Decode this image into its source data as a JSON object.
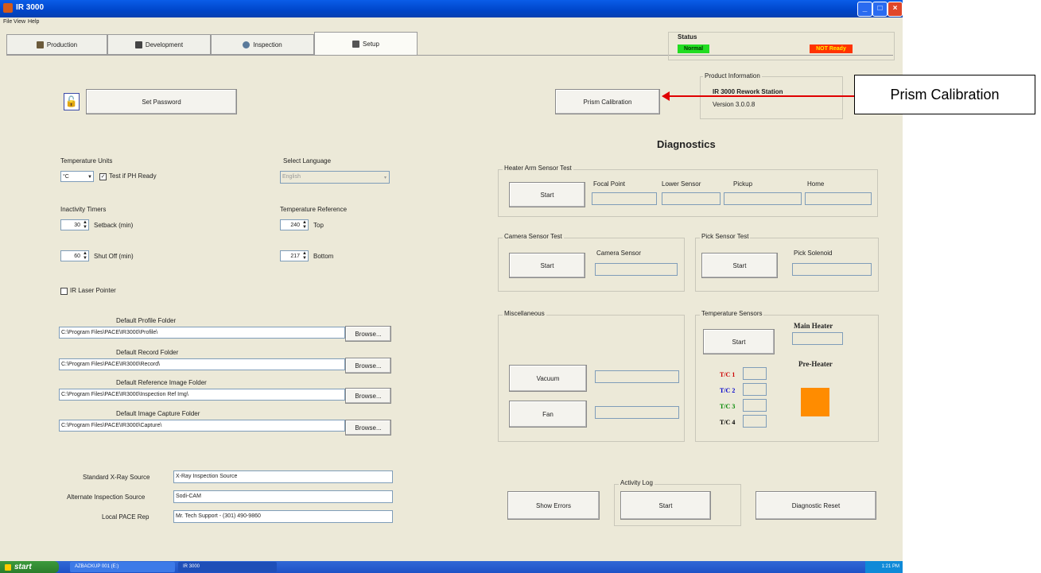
{
  "window": {
    "title": "IR 3000"
  },
  "menu": [
    "File",
    "View",
    "Help"
  ],
  "tabs": [
    {
      "label": "Production"
    },
    {
      "label": "Development"
    },
    {
      "label": "Inspection"
    },
    {
      "label": "Setup"
    }
  ],
  "status": {
    "label": "Status",
    "normal": "Normal",
    "not_ready": "NOT Ready",
    "normal_color": "#22dd22",
    "not_ready_color": "#ff3300"
  },
  "set_password": {
    "label": "Set Password"
  },
  "prism": {
    "label": "Prism Calibration"
  },
  "product_info": {
    "group": "Product Information",
    "name": "IR 3000 Rework Station",
    "version": "Version 3.0.0.8"
  },
  "callout": {
    "label": "Prism Calibration"
  },
  "temperature_units": {
    "label": "Temperature Units",
    "value": "°C",
    "test_ph_label": "Test if PH Ready"
  },
  "language": {
    "label": "Select Language",
    "value": "English"
  },
  "inactivity": {
    "label": "Inactivity Timers",
    "setback_value": "30",
    "setback_label": "Setback (min)",
    "shutoff_value": "60",
    "shutoff_label": "Shut Off (min)"
  },
  "temp_ref": {
    "label": "Temperature Reference",
    "top_value": "240",
    "top_label": "Top",
    "bottom_value": "217",
    "bottom_label": "Bottom"
  },
  "laser": {
    "label": "IR Laser Pointer"
  },
  "folders": [
    {
      "label": "Default Profile Folder",
      "path": "C:\\Program Files\\PACE\\IR3000\\Profile\\",
      "browse": "Browse..."
    },
    {
      "label": "Default Record Folder",
      "path": "C:\\Program Files\\PACE\\IR3000\\Record\\",
      "browse": "Browse..."
    },
    {
      "label": "Default Reference Image Folder",
      "path": "C:\\Program Files\\PACE\\IR3000\\Inspection Ref Img\\",
      "browse": "Browse..."
    },
    {
      "label": "Default Image Capture Folder",
      "path": "C:\\Program Files\\PACE\\IR3000\\Capture\\",
      "browse": "Browse..."
    }
  ],
  "sources": [
    {
      "label": "Standard X-Ray Source",
      "value": "X-Ray Inspection Source"
    },
    {
      "label": "Alternate Inspection Source",
      "value": "Sodi-CAM"
    },
    {
      "label": "Local PACE Rep",
      "value": "Mr. Tech Support - (301) 490-9860"
    }
  ],
  "diagnostics": {
    "title": "Diagnostics",
    "heater_arm": {
      "label": "Heater Arm Sensor Test",
      "start": "Start",
      "cols": [
        "Focal Point",
        "Lower Sensor",
        "Pickup",
        "Home"
      ]
    },
    "camera": {
      "label": "Camera Sensor Test",
      "start": "Start",
      "sensor": "Camera Sensor"
    },
    "pick": {
      "label": "Pick Sensor Test",
      "start": "Start",
      "sensor": "Pick Solenoid"
    },
    "misc": {
      "label": "Miscellaneous",
      "vacuum": "Vacuum",
      "fan": "Fan"
    },
    "temp_sensors": {
      "label": "Temperature Sensors",
      "start": "Start",
      "main_heater": "Main Heater",
      "pre_heater": "Pre-Heater",
      "tc": [
        "T/C 1",
        "T/C 2",
        "T/C 3",
        "T/C 4"
      ],
      "tc_colors": [
        "#cc0000",
        "#0000cc",
        "#008800",
        "#000000"
      ],
      "pre_heater_color": "#ff8c00"
    },
    "show_errors": "Show Errors",
    "activity_log": {
      "label": "Activity Log",
      "start": "Start"
    },
    "reset": "Diagnostic Reset"
  },
  "taskbar": {
    "start": "start",
    "items": [
      "AZBACKUP 001 (E:)",
      "IR 3000"
    ],
    "clock": "1:21 PM"
  }
}
